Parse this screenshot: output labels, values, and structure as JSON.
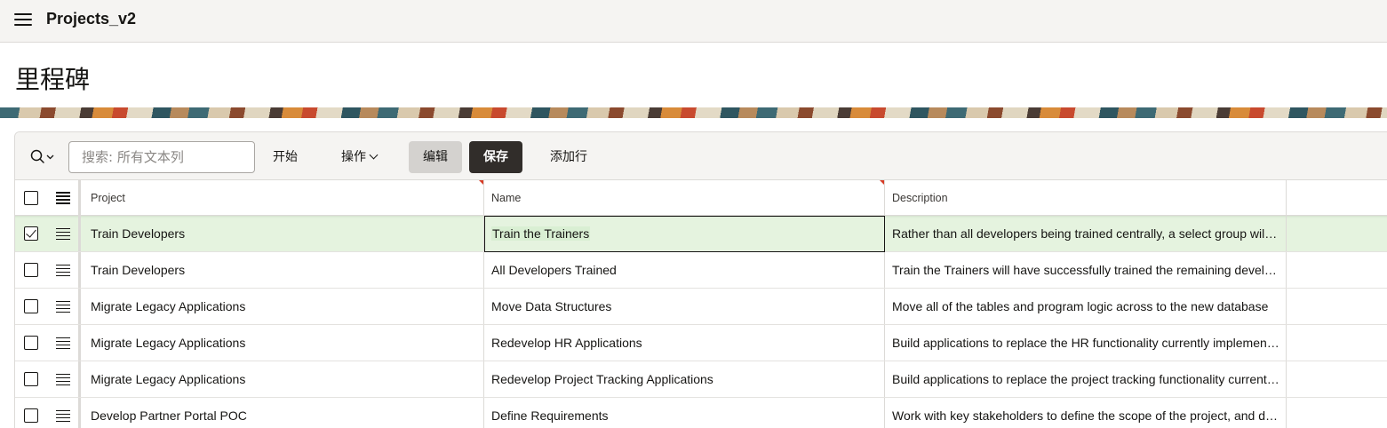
{
  "app": {
    "title": "Projects_v2"
  },
  "page": {
    "title": "里程碑"
  },
  "toolbar": {
    "search_placeholder": "搜索: 所有文本列",
    "start_label": "开始",
    "actions_label": "操作",
    "edit_label": "编辑",
    "save_label": "保存",
    "add_row_label": "添加行"
  },
  "grid": {
    "columns": {
      "project": "Project",
      "name": "Name",
      "description": "Description"
    },
    "rows": [
      {
        "project": "Train Developers",
        "name": "Train the Trainers",
        "description": "Rather than all developers being trained centrally, a select group will be trained first",
        "selected": true
      },
      {
        "project": "Train Developers",
        "name": "All Developers Trained",
        "description": "Train the Trainers will have successfully trained the remaining developers",
        "selected": false
      },
      {
        "project": "Migrate Legacy Applications",
        "name": "Move Data Structures",
        "description": "Move all of the tables and program logic across to the new database",
        "selected": false
      },
      {
        "project": "Migrate Legacy Applications",
        "name": "Redevelop HR Applications",
        "description": "Build applications to replace the HR functionality currently implemented",
        "selected": false
      },
      {
        "project": "Migrate Legacy Applications",
        "name": "Redevelop Project Tracking Applications",
        "description": "Build applications to replace the project tracking functionality currently implemented",
        "selected": false
      },
      {
        "project": "Develop Partner Portal POC",
        "name": "Define Requirements",
        "description": "Work with key stakeholders to define the scope of the project, and design the application",
        "selected": false
      }
    ]
  },
  "colors": {
    "selected_row": "#e5f3df",
    "save_button": "#312d2a",
    "edit_button": "#d4d2cf",
    "required_flag": "#d63b25"
  },
  "icons": [
    "hamburger-menu-icon",
    "search-icon",
    "chevron-down-icon",
    "row-actions-icon",
    "checkbox-icon"
  ]
}
